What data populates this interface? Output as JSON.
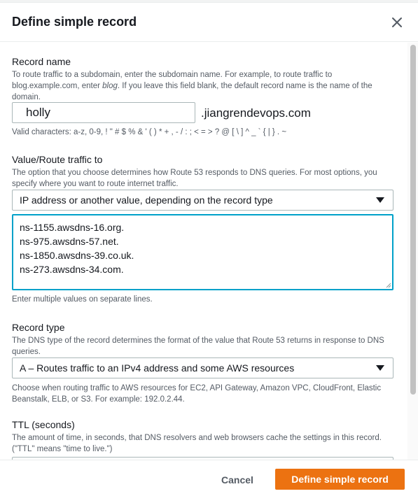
{
  "modal": {
    "title": "Define simple record",
    "close_icon": "close-icon"
  },
  "record_name": {
    "label": "Record name",
    "description_part1": "To route traffic to a subdomain, enter the subdomain name. For example, to route traffic to blog.example.com, enter ",
    "description_italic": "blog",
    "description_part2": ". If you leave this field blank, the default record name is the name of the domain.",
    "value": "holly",
    "suffix": ".jiangrendevops.com",
    "hint": "Valid characters: a-z, 0-9, ! \" # $ % & ' ( ) * + , - / : ; < = > ? @ [ \\ ] ^ _ ` { | } . ~"
  },
  "value_route": {
    "label": "Value/Route traffic to",
    "description": "The option that you choose determines how Route 53 responds to DNS queries. For most options, you specify where you want to route internet traffic.",
    "selected": "IP address or another value, depending on the record type",
    "values": [
      "ns-1155.awsdns-16.org.",
      "ns-975.awsdns-57.net.",
      "ns-1850.awsdns-39.co.uk.",
      "ns-273.awsdns-34.com."
    ],
    "hint": "Enter multiple values on separate lines."
  },
  "record_type": {
    "label": "Record type",
    "description": "The DNS type of the record determines the format of the value that Route 53 returns in response to DNS queries.",
    "selected": "A – Routes traffic to an IPv4 address and some AWS resources",
    "hint": "Choose when routing traffic to AWS resources for EC2, API Gateway, Amazon VPC, CloudFront, Elastic Beanstalk, ELB, or S3. For example: 192.0.2.44."
  },
  "ttl": {
    "label": "TTL (seconds)",
    "description": "The amount of time, in seconds, that DNS resolvers and web browsers cache the settings in this record. (\"TTL\" means \"time to live.\")"
  },
  "footer": {
    "cancel_label": "Cancel",
    "primary_label": "Define simple record"
  },
  "colors": {
    "primary": "#ec7211",
    "focus": "#00a1c9"
  }
}
